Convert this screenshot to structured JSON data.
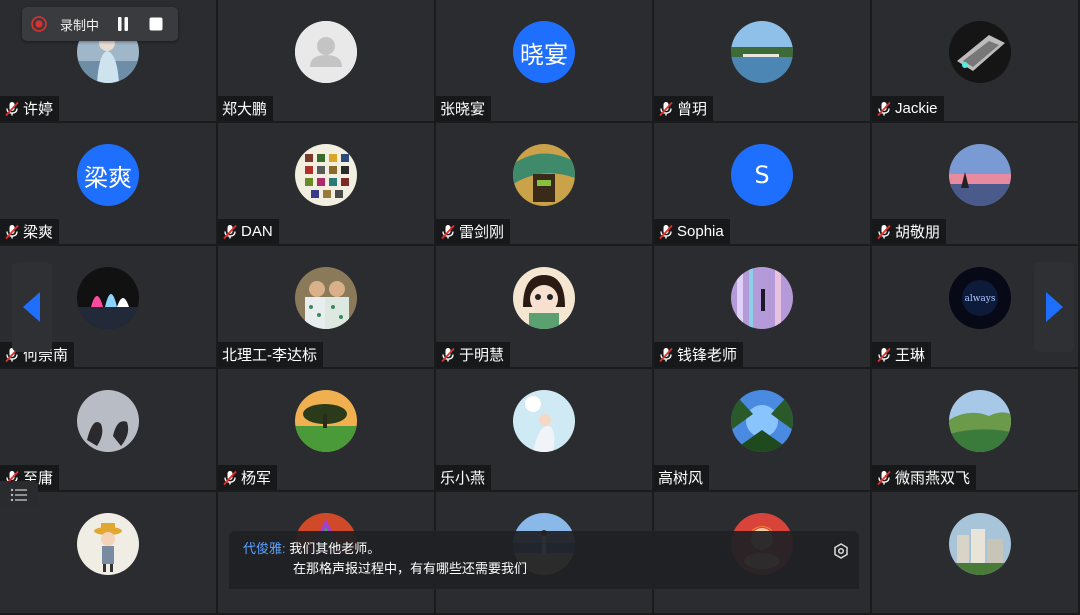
{
  "recording": {
    "status_label": "录制中",
    "dot_color": "#e0302e"
  },
  "participants": [
    {
      "name": "许婷",
      "muted": true,
      "avatar": {
        "kind": "photo",
        "icon": "person-photo"
      }
    },
    {
      "name": "郑大鹏",
      "muted": false,
      "avatar": {
        "kind": "default",
        "icon": "default-person-icon"
      }
    },
    {
      "name": "张晓宴",
      "muted": false,
      "avatar": {
        "kind": "text",
        "text": "晓宴"
      }
    },
    {
      "name": "曾玥",
      "muted": true,
      "avatar": {
        "kind": "photo",
        "icon": "lake-bridge-photo"
      }
    },
    {
      "name": "Jackie",
      "muted": true,
      "avatar": {
        "kind": "photo",
        "icon": "spaceship-photo"
      }
    },
    {
      "name": "梁爽",
      "muted": true,
      "avatar": {
        "kind": "text",
        "text": "梁爽"
      }
    },
    {
      "name": "DAN",
      "muted": true,
      "avatar": {
        "kind": "photo",
        "icon": "photo-collage"
      }
    },
    {
      "name": "雷剑刚",
      "muted": true,
      "avatar": {
        "kind": "photo",
        "icon": "green-art-photo"
      }
    },
    {
      "name": "Sophia",
      "muted": true,
      "avatar": {
        "kind": "text",
        "text": "S"
      }
    },
    {
      "name": "胡敬朋",
      "muted": true,
      "avatar": {
        "kind": "photo",
        "icon": "sunset-sky-photo"
      }
    },
    {
      "name": "何崇南",
      "muted": true,
      "avatar": {
        "kind": "photo",
        "icon": "night-fountain-photo"
      }
    },
    {
      "name": "北理工-李达标",
      "muted": false,
      "avatar": {
        "kind": "photo",
        "icon": "two-people-photo"
      }
    },
    {
      "name": "于明慧",
      "muted": true,
      "avatar": {
        "kind": "photo",
        "icon": "cartoon-girl-photo"
      }
    },
    {
      "name": "钱锋老师",
      "muted": true,
      "avatar": {
        "kind": "photo",
        "icon": "light-room-photo"
      }
    },
    {
      "name": "王琳",
      "muted": true,
      "avatar": {
        "kind": "photo",
        "icon": "dark-always-photo"
      }
    },
    {
      "name": "至庸",
      "muted": true,
      "avatar": {
        "kind": "photo",
        "icon": "hands-shadow-photo"
      }
    },
    {
      "name": "杨军",
      "muted": true,
      "avatar": {
        "kind": "photo",
        "icon": "tree-sunset-photo"
      }
    },
    {
      "name": "乐小燕",
      "muted": false,
      "avatar": {
        "kind": "photo",
        "icon": "anime-sky-photo"
      }
    },
    {
      "name": "高树风",
      "muted": false,
      "avatar": {
        "kind": "photo",
        "icon": "trees-sky-photo"
      }
    },
    {
      "name": "微雨燕双飞",
      "muted": true,
      "avatar": {
        "kind": "photo",
        "icon": "valley-photo"
      }
    },
    {
      "name": "",
      "muted": false,
      "avatar": {
        "kind": "photo",
        "icon": "cartoon-hat-photo"
      }
    },
    {
      "name": "",
      "muted": false,
      "avatar": {
        "kind": "photo",
        "icon": "tree-art-photo"
      }
    },
    {
      "name": "",
      "muted": false,
      "avatar": {
        "kind": "photo",
        "icon": "beach-person-photo"
      }
    },
    {
      "name": "",
      "muted": false,
      "avatar": {
        "kind": "photo",
        "icon": "meditation-cartoon-photo"
      }
    },
    {
      "name": "",
      "muted": false,
      "avatar": {
        "kind": "photo",
        "icon": "city-buildings-photo"
      }
    }
  ],
  "caption": {
    "speaker": "代俊雅:",
    "line1": "我们其他老师。",
    "line2": "在那格声报过程中，有有哪些还需要我们"
  }
}
